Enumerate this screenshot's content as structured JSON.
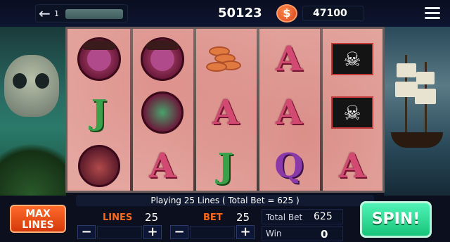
{
  "topbar": {
    "back_icon": "arrow-left-icon",
    "level": "1",
    "balance": "50123",
    "coin_icon": "coin-icon",
    "coin_symbol": "$",
    "coins": "47100",
    "menu_icon": "hamburger-menu-icon"
  },
  "reels": {
    "rows": [
      [
        "pirate-captain",
        "pirate-captain",
        "coins",
        "A",
        "pirate-flag"
      ],
      [
        "J",
        "parrot",
        "A",
        "A",
        "pirate-flag"
      ],
      [
        "pirate-hat",
        "A",
        "J",
        "Q",
        "A"
      ]
    ]
  },
  "status": "Playing 25 Lines ( Total Bet = 625 )",
  "controls": {
    "max_lines_label": "MAX\nLINES",
    "lines_label": "LINES",
    "lines_value": "25",
    "bet_label": "BET",
    "bet_value": "25",
    "minus": "−",
    "plus": "+",
    "total_bet_label": "Total Bet",
    "total_bet_value": "625",
    "win_label": "Win",
    "win_value": "0",
    "spin_label": "SPIN!"
  },
  "colors": {
    "accent_orange": "#ff6a1a",
    "spin_green": "#2bd98e",
    "reel_bg": "#e4a7a0"
  }
}
